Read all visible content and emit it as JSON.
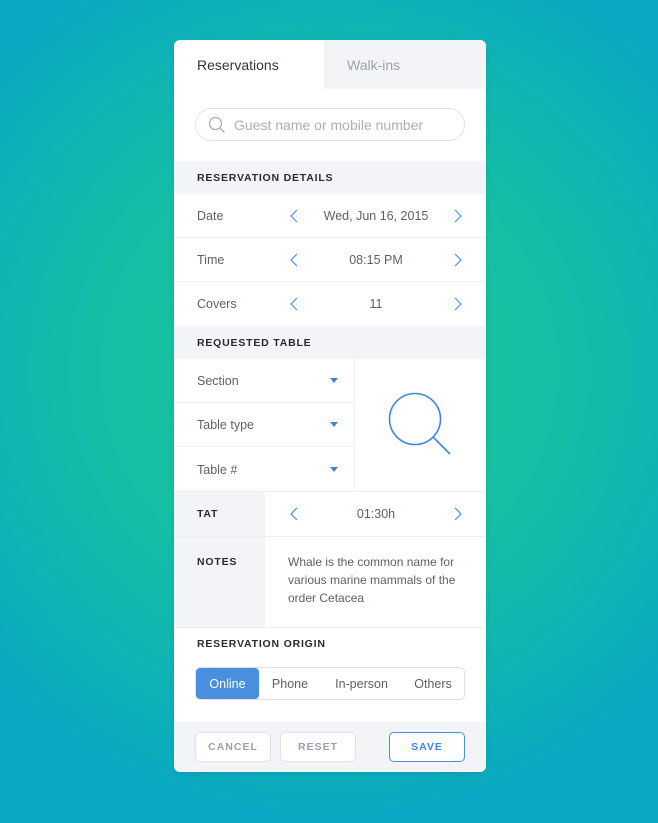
{
  "tabs": [
    {
      "label": "Reservations",
      "active": true
    },
    {
      "label": "Walk-ins",
      "active": false
    }
  ],
  "search": {
    "placeholder": "Guest name or mobile number",
    "value": "",
    "icon": "search-icon"
  },
  "reservation_details": {
    "title": "RESERVATION DETAILS",
    "rows": [
      {
        "label": "Date",
        "value": "Wed, Jun 16, 2015"
      },
      {
        "label": "Time",
        "value": "08:15 PM"
      },
      {
        "label": "Covers",
        "value": "11"
      }
    ]
  },
  "requested_table": {
    "title": "REQUESTED TABLE",
    "dropdowns": [
      {
        "label": "Section"
      },
      {
        "label": "Table type"
      },
      {
        "label": "Table #"
      }
    ],
    "preview_icon": "magnifier-icon"
  },
  "tat": {
    "label": "TAT",
    "value": "01:30h"
  },
  "notes": {
    "label": "NOTES",
    "text": "Whale is the common name for various marine mammals of the order Cetacea"
  },
  "origin": {
    "title": "RESERVATION ORIGIN",
    "options": [
      "Online",
      "Phone",
      "In-person",
      "Others"
    ],
    "selected": "Online"
  },
  "footer": {
    "cancel": "CANCEL",
    "reset": "RESET",
    "save": "SAVE"
  },
  "colors": {
    "accent": "#4a8ee0",
    "section_bg": "#f3f4f8",
    "text": "#5b616b",
    "heading": "#262b33"
  }
}
